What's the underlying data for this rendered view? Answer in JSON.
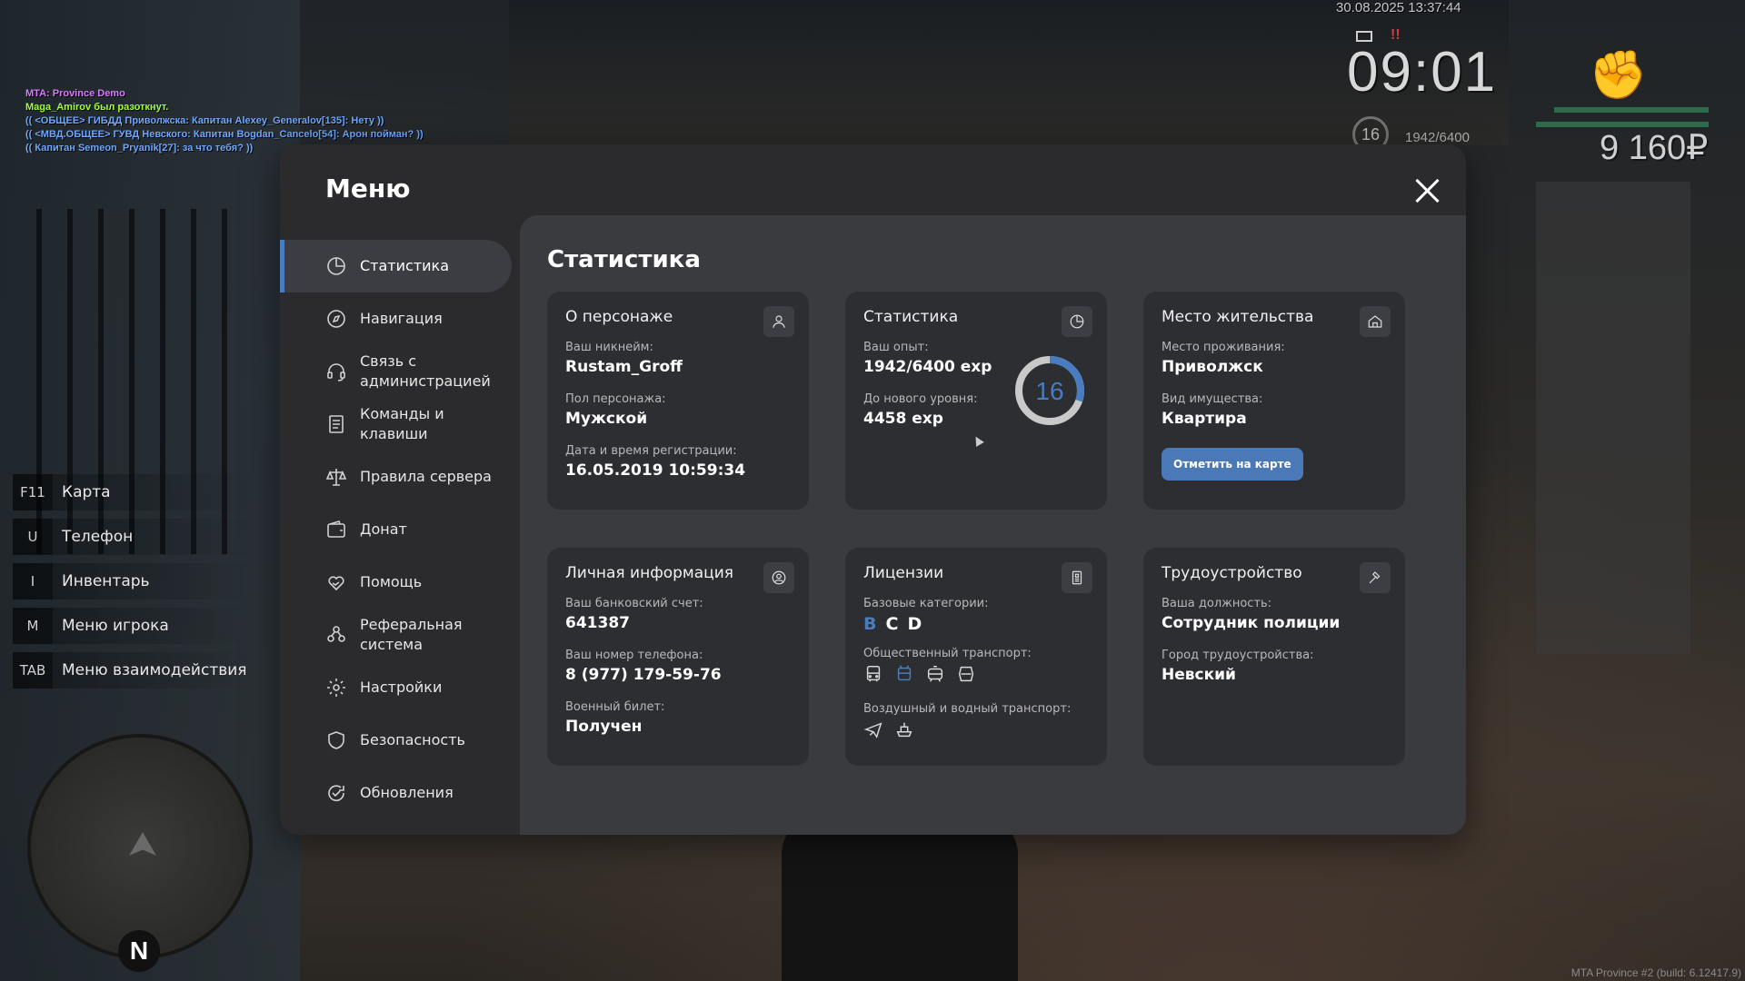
{
  "chat": [
    {
      "text": "MTA: Province Demo",
      "color": "#d77cff"
    },
    {
      "text": "Maga_Amirov был разоткнут.",
      "color": "#a0ff40"
    },
    {
      "text": "(( <ОБЩЕЕ> ГИБДД Приволжска: Капитан Alexey_Generalov[135]: Нету ))",
      "color": "#6ea8ff"
    },
    {
      "text": "(( <МВД.ОБЩЕЕ> ГУВД Невского: Капитан Bogdan_Cancelo[54]: Арон пойман? ))",
      "color": "#6ea8ff"
    },
    {
      "text": "(( Капитан Semeon_Pryanik[27]: за что тебя? ))",
      "color": "#6ea8ff"
    }
  ],
  "hud": {
    "datetime": "30.08.2025 13:37:44",
    "time": "09:01",
    "alert": "!!",
    "level": "16",
    "exp": "1942/6400",
    "money": "9 160₽"
  },
  "hotkeys": [
    {
      "key": "F11",
      "label": "Карта"
    },
    {
      "key": "U",
      "label": "Телефон"
    },
    {
      "key": "I",
      "label": "Инвентарь"
    },
    {
      "key": "M",
      "label": "Меню игрока"
    },
    {
      "key": "TAB",
      "label": "Меню взаимодействия"
    }
  ],
  "minimap": {
    "north": "N"
  },
  "build": "MTA Province #2 (build: 6.12417.9)",
  "menu": {
    "title": "Меню",
    "nav": [
      {
        "label": "Статистика",
        "icon": "pie-chart-icon",
        "active": true
      },
      {
        "label": "Навигация",
        "icon": "compass-icon"
      },
      {
        "label": "Связь с администрацией",
        "icon": "headset-icon"
      },
      {
        "label": "Команды и клавиши",
        "icon": "document-list-icon"
      },
      {
        "label": "Правила сервера",
        "icon": "scales-icon"
      },
      {
        "label": "Донат",
        "icon": "wallet-icon"
      },
      {
        "label": "Помощь",
        "icon": "heart-hand-icon"
      },
      {
        "label": "Реферальная система",
        "icon": "people-icon"
      },
      {
        "label": "Настройки",
        "icon": "gear-icon"
      },
      {
        "label": "Безопасность",
        "icon": "shield-icon"
      },
      {
        "label": "Обновления",
        "icon": "refresh-check-icon"
      }
    ],
    "section_title": "Статистика",
    "cards": {
      "character": {
        "title": "О персонаже",
        "nickname_label": "Ваш никнейм:",
        "nickname": "Rustam_Groff",
        "gender_label": "Пол персонажа:",
        "gender": "Мужской",
        "reg_label": "Дата и время регистрации:",
        "reg": "16.05.2019 10:59:34"
      },
      "stats": {
        "title": "Статистика",
        "exp_label": "Ваш опыт:",
        "exp": "1942/6400 exp",
        "next_label": "До нового уровня:",
        "next": "4458 exp",
        "level": "16",
        "progress": 0.303
      },
      "residence": {
        "title": "Место жительства",
        "place_label": "Место проживания:",
        "place": "Приволжск",
        "type_label": "Вид имущества:",
        "type": "Квартира",
        "button": "Отметить на карте"
      },
      "personal": {
        "title": "Личная информация",
        "bank_label": "Ваш банковский счет:",
        "bank": "641387",
        "phone_label": "Ваш номер телефона:",
        "phone": "8 (977) 179-59-76",
        "military_label": "Военный билет:",
        "military": "Получен"
      },
      "licenses": {
        "title": "Лицензии",
        "base_label": "Базовые категории:",
        "categories": [
          "B",
          "C",
          "D"
        ],
        "public_label": "Общественный транспорт:",
        "air_label": "Воздушный и водный транспорт:"
      },
      "job": {
        "title": "Трудоустройство",
        "position_label": "Ваша должность:",
        "position": "Сотрудник полиции",
        "city_label": "Город трудоустройства:",
        "city": "Невский"
      }
    }
  },
  "colors": {
    "accent": "#4a7cc0",
    "panel": "#2b2b2e",
    "content": "#3a3b3f",
    "card": "#2d2e31"
  }
}
